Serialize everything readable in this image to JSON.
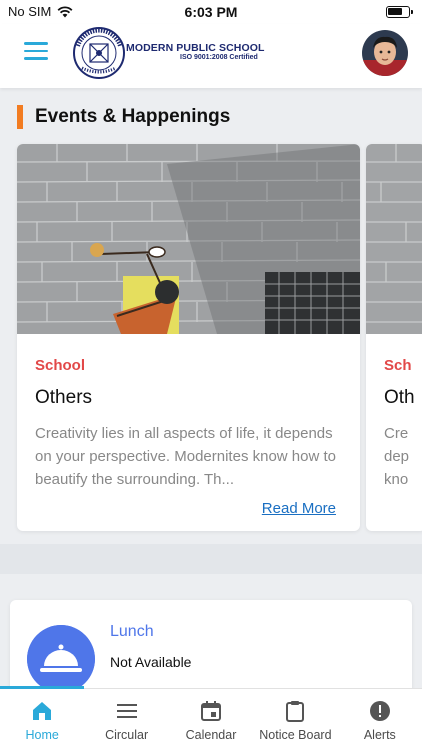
{
  "status_bar": {
    "carrier": "No SIM",
    "time": "6:03 PM"
  },
  "header": {
    "school_name": "MODERN PUBLIC SCHOOL",
    "school_subtitle": "ISO 9001:2008 Certified"
  },
  "events": {
    "section_title": "Events & Happenings",
    "cards": [
      {
        "category": "School",
        "title": "Others",
        "description": "Creativity lies in all aspects of life, it depends on your perspective. Modernites know how to beautify the surrounding. Th...",
        "read_more": "Read More"
      },
      {
        "category": "Sch",
        "title": "Oth",
        "description_lines": [
          "Cre",
          "dep",
          "kno"
        ]
      }
    ]
  },
  "lunch": {
    "title": "Lunch",
    "value": "Not Available"
  },
  "nav": {
    "items": [
      {
        "label": "Home",
        "icon": "home-icon",
        "active": true
      },
      {
        "label": "Circular",
        "icon": "menu-lines-icon"
      },
      {
        "label": "Calendar",
        "icon": "calendar-icon"
      },
      {
        "label": "Notice Board",
        "icon": "clipboard-icon"
      },
      {
        "label": "Alerts",
        "icon": "alert-icon"
      }
    ]
  },
  "colors": {
    "accent": "#2aa9d9",
    "section_bar": "#f27c22",
    "category": "#e24848",
    "lunch_blue": "#4f76e9",
    "link": "#1a6fc2"
  }
}
